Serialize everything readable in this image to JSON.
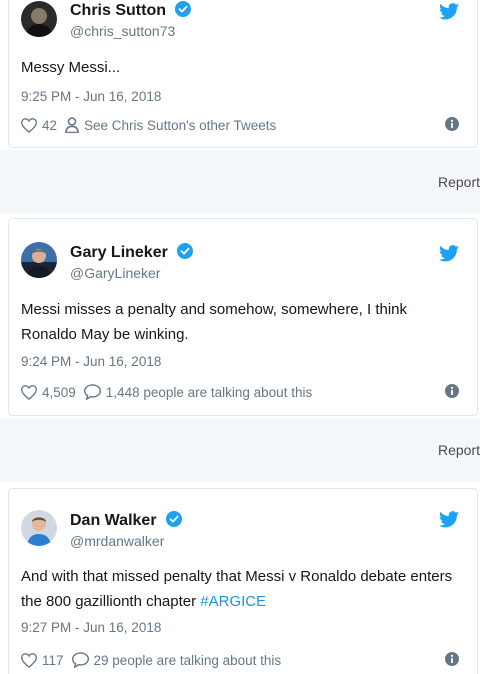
{
  "tweets": [
    {
      "name": "Chris Sutton",
      "handle": "@chris_sutton73",
      "text": "Messy Messi...",
      "time": "9:25 PM - Jun 16, 2018",
      "likes": "42",
      "secondary": "See Chris Sutton's other Tweets",
      "secondary_icon": "person-icon"
    },
    {
      "name": "Gary Lineker",
      "handle": "@GaryLineker",
      "text": "Messi misses a penalty and somehow, somewhere, I think Ronaldo May be winking.",
      "time": "9:24 PM - Jun 16, 2018",
      "likes": "4,509",
      "secondary": "1,448 people are talking about this",
      "secondary_icon": "comment-icon"
    },
    {
      "name": "Dan Walker",
      "handle": "@mrdanwalker",
      "text": "And with that missed penalty that Messi v Ronaldo debate enters the 800 gazillionth chapter",
      "hashtag": "#ARGICE",
      "time": "9:27 PM - Jun 16, 2018",
      "likes": "117",
      "secondary": "29 people are talking about this",
      "secondary_icon": "comment-icon"
    }
  ],
  "report_label": "Report",
  "colors": {
    "twitter_blue": "#1da1f2",
    "muted": "#657786",
    "border": "#e1e8ed"
  }
}
